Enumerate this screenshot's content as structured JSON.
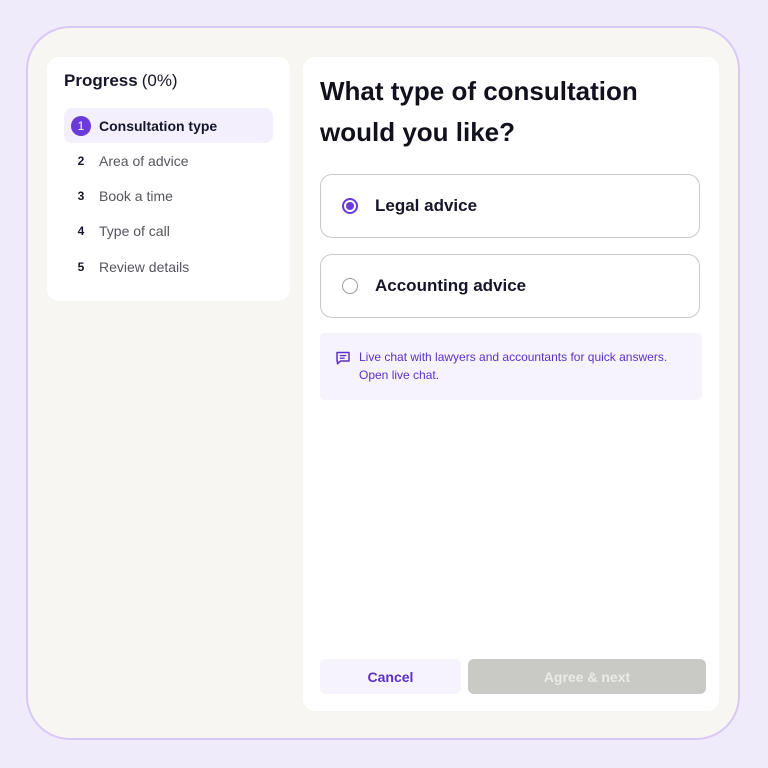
{
  "progress": {
    "title": "Progress",
    "percent_label": "(0%)",
    "steps": [
      {
        "number": "1",
        "label": "Consultation type",
        "active": true
      },
      {
        "number": "2",
        "label": "Area of advice",
        "active": false
      },
      {
        "number": "3",
        "label": "Book a time",
        "active": false
      },
      {
        "number": "4",
        "label": "Type of call",
        "active": false
      },
      {
        "number": "5",
        "label": "Review details",
        "active": false
      }
    ]
  },
  "main": {
    "question": "What type of consultation would you like?",
    "options": [
      {
        "label": "Legal advice",
        "selected": true
      },
      {
        "label": "Accounting advice",
        "selected": false
      }
    ],
    "chat_info": {
      "text": "Live chat with lawyers and accountants for quick answers.",
      "link": "Open live chat.",
      "icon": "chat-bubble-icon"
    },
    "buttons": {
      "cancel": "Cancel",
      "next": "Agree & next"
    }
  },
  "colors": {
    "accent": "#6a3bd8",
    "accent_text": "#5b31c9",
    "accent_soft": "#f6f3fd",
    "disabled_button": "#c9c9c5",
    "frame_border": "#d8c8f6"
  }
}
